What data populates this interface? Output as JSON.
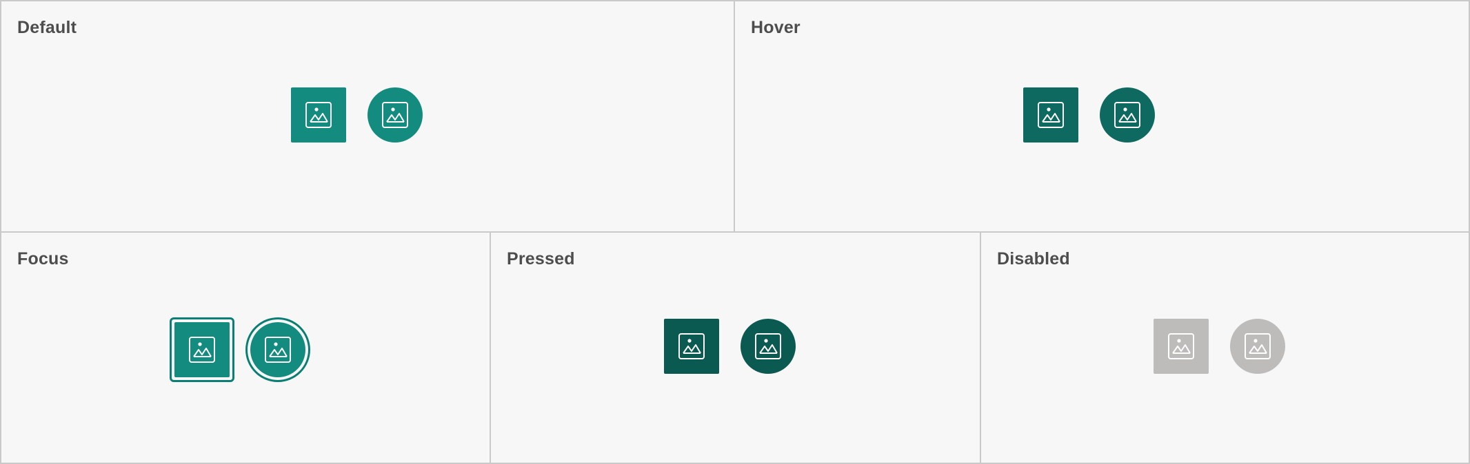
{
  "panels": {
    "default": {
      "title": "Default",
      "color": "#138b7e"
    },
    "hover": {
      "title": "Hover",
      "color": "#0e6a61"
    },
    "focus": {
      "title": "Focus",
      "color": "#138b7e",
      "ring_color": "#0b7e73"
    },
    "pressed": {
      "title": "Pressed",
      "color": "#0b5a52"
    },
    "disabled": {
      "title": "Disabled",
      "color": "#bebcbb"
    }
  },
  "buttons": {
    "square_icon": "image-icon",
    "round_icon": "image-icon"
  }
}
